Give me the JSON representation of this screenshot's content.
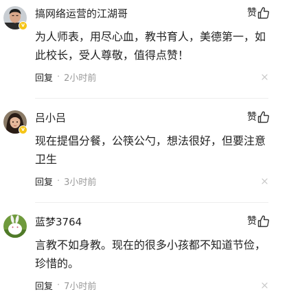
{
  "comments": [
    {
      "username": "搞网络运营的江湖哥",
      "verified": true,
      "avatar": "man-portrait-dark-hair",
      "like_label": "赞",
      "text": "为人师表，用尽心血，教书育人，美德第一，如此校长，受人尊敬，值得点赞！",
      "reply_label": "回复",
      "separator": "·",
      "time": "2小时前"
    },
    {
      "username": "吕小吕",
      "verified": true,
      "avatar": "person-portrait-long-hair",
      "like_label": "赞",
      "text": "现在提倡分餐，公筷公勺，想法很好，但要注意卫生",
      "reply_label": "回复",
      "separator": "·",
      "time": "3小时前"
    },
    {
      "username": "蓝梦3764",
      "verified": false,
      "avatar": "white-rabbit-on-grass",
      "like_label": "赞",
      "text": "言教不如身教。现在的很多小孩都不知道节俭，珍惜的。",
      "reply_label": "回复",
      "separator": "·",
      "time": "7小时前"
    }
  ],
  "icons": {
    "like": "thumbs-up-icon",
    "close": "close-icon",
    "verified": "verified-badge-icon"
  },
  "colors": {
    "text": "#222222",
    "meta": "#999999",
    "badge": "#f5c518",
    "divider": "#eeeeee"
  }
}
